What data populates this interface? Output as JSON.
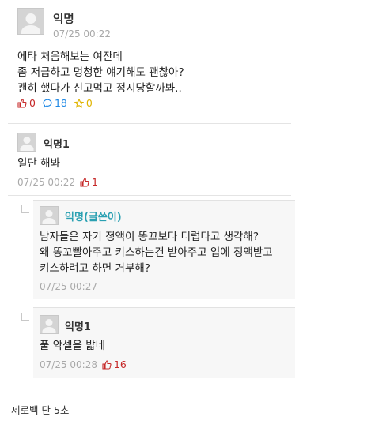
{
  "post": {
    "author": "익명",
    "time": "07/25 00:22",
    "lines": [
      "에타 처음해보는 여잔데",
      "좀 저급하고 멍청한 얘기해도 괜찮아?",
      "괜히 했다가 신고먹고 정지당할까봐.."
    ],
    "likes": "0",
    "comments": "18",
    "scraps": "0"
  },
  "comments": [
    {
      "author": "익명1",
      "text": "일단 해봐",
      "time": "07/25 00:22",
      "likes": "1"
    }
  ],
  "replies": [
    {
      "author": "익명(글쓴이)",
      "lines": [
        "남자들은 자기 정액이 똥꼬보다 더럽다고 생각해?",
        "왜 똥꼬빨아주고 키스하는건 받아주고 입에 정액받고",
        "키스하려고 하면 거부해?"
      ],
      "time": "07/25 00:27"
    },
    {
      "author": "익명1",
      "text": "풀 악셀을 밟네",
      "time": "07/25 00:28",
      "likes": "16"
    }
  ],
  "caption": "제로백 단 5초",
  "colors": {
    "like": "#c62828",
    "comment": "#1e88e5",
    "scrap": "#e0b400",
    "op_author": "#2aa0b2"
  }
}
